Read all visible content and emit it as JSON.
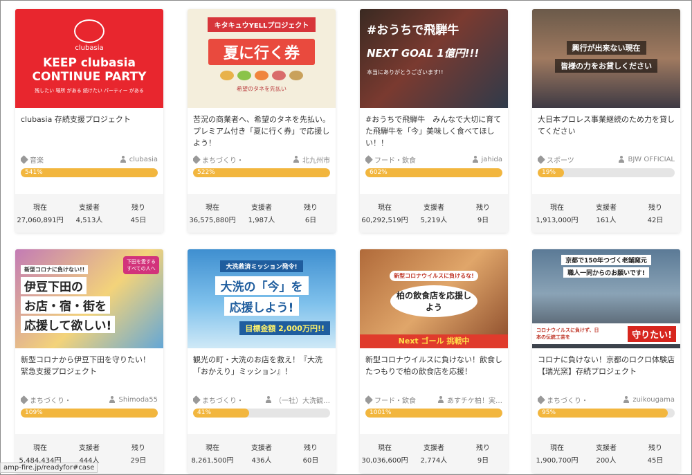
{
  "cards": [
    {
      "thumb": {
        "line1": "KEEP clubasia",
        "line2": "CONTINUE PARTY",
        "line3": "残したい 場所 がある  続けたい パーティー がある",
        "logo": "clubasia"
      },
      "title": "clubasia 存続支援プロジェクト",
      "category": "音楽",
      "owner": "clubasia",
      "percent": "541%",
      "fill": 1.0,
      "stats": {
        "current_label": "現在",
        "current": "27,060,891円",
        "backers_label": "支援者",
        "backers": "4,513人",
        "left_label": "残り",
        "left": "45日"
      }
    },
    {
      "thumb": {
        "line1": "キタキュウYELLプロジェクト",
        "line2": "夏に行く券",
        "line3": "希望のタネを先払い"
      },
      "title": "苦況の商業者へ、希望のタネを先払い。プレミアム付き「夏に行く券」で応援しよう！",
      "category": "まちづくり・",
      "owner": "北九州市",
      "percent": "522%",
      "fill": 1.0,
      "stats": {
        "current_label": "現在",
        "current": "36,575,880円",
        "backers_label": "支援者",
        "backers": "1,987人",
        "left_label": "残り",
        "left": "6日"
      }
    },
    {
      "thumb": {
        "line1": "#おうちで飛騨牛",
        "line2": "NEXT GOAL 1億円!!!",
        "line3": "本当にありがとうございます!!"
      },
      "title": "#おうちで飛騨牛　みんなで大切に育てた飛騨牛を「今」美味しく食べてほしい！！",
      "category": "フード・飲食",
      "owner": "jahida",
      "percent": "602%",
      "fill": 1.0,
      "stats": {
        "current_label": "現在",
        "current": "60,292,519円",
        "backers_label": "支援者",
        "backers": "5,219人",
        "left_label": "残り",
        "left": "9日"
      }
    },
    {
      "thumb": {
        "line1": "興行が出来ない現在",
        "line2": "皆様の力をお貸しください"
      },
      "title": "大日本プロレス事業継続のため力を貸してください",
      "category": "スポーツ",
      "owner": "BJW OFFICIAL",
      "percent": "19%",
      "fill": 0.19,
      "stats": {
        "current_label": "現在",
        "current": "1,913,000円",
        "backers_label": "支援者",
        "backers": "161人",
        "left_label": "残り",
        "left": "42日"
      }
    },
    {
      "thumb": {
        "line1": "新型コロナに負けない!!",
        "line2": "伊豆下田の",
        "line3": "お店・宿・街を",
        "line4": "応援して欲しい!",
        "badge": "下田を愛するすべての人へ"
      },
      "title": "新型コロナから伊豆下田を守りたい！　緊急支援プロジェクト",
      "category": "まちづくり・",
      "owner": "Shimoda55",
      "percent": "109%",
      "fill": 1.0,
      "stats": {
        "current_label": "現在",
        "current": "5,484,434円",
        "backers_label": "支援者",
        "backers": "444人",
        "left_label": "残り",
        "left": "29日"
      }
    },
    {
      "thumb": {
        "line1": "大洗救済ミッション発令!",
        "line2": "大洗の「今」を",
        "line3": "応援しよう!",
        "line4": "目標金額 2,000万円!!"
      },
      "title": "観光の町・大洗のお店を救え！『大洗「おかえり」ミッション』！",
      "category": "まちづくり・",
      "owner": "（一社）大洗観…",
      "percent": "41%",
      "fill": 0.41,
      "stats": {
        "current_label": "現在",
        "current": "8,261,500円",
        "backers_label": "支援者",
        "backers": "436人",
        "left_label": "残り",
        "left": "60日"
      }
    },
    {
      "thumb": {
        "line1": "新型コロナウイルスに負けるな!",
        "line2": "柏の飲食店を応援しよう",
        "line3": "Next ゴール 挑戦中"
      },
      "title": "新型コロナウイルスに負けない！飲食したつもりで柏の飲食店を応援！",
      "category": "フード・飲食",
      "owner": "あすチケ柏！実…",
      "percent": "1001%",
      "fill": 1.0,
      "stats": {
        "current_label": "現在",
        "current": "30,036,600円",
        "backers_label": "支援者",
        "backers": "2,774人",
        "left_label": "残り",
        "left": "9日"
      }
    },
    {
      "thumb": {
        "line1": "京都で150年つづく老舗窯元",
        "line2": "職人一同からのお願いです!",
        "line3": "コロナウイルスに負けず、日本の伝統工芸を",
        "line4": "守りたい!"
      },
      "title": "コロナに負けない！京都のロクロ体験店【瑞光窯】存続プロジェクト",
      "category": "まちづくり・",
      "owner": "zuikougama",
      "percent": "95%",
      "fill": 0.95,
      "stats": {
        "current_label": "現在",
        "current": "1,900,700円",
        "backers_label": "支援者",
        "backers": "200人",
        "left_label": "残り",
        "left": "45日"
      }
    }
  ],
  "status_bar": {
    "url": "amp-fire.jp/readyfor#case"
  }
}
